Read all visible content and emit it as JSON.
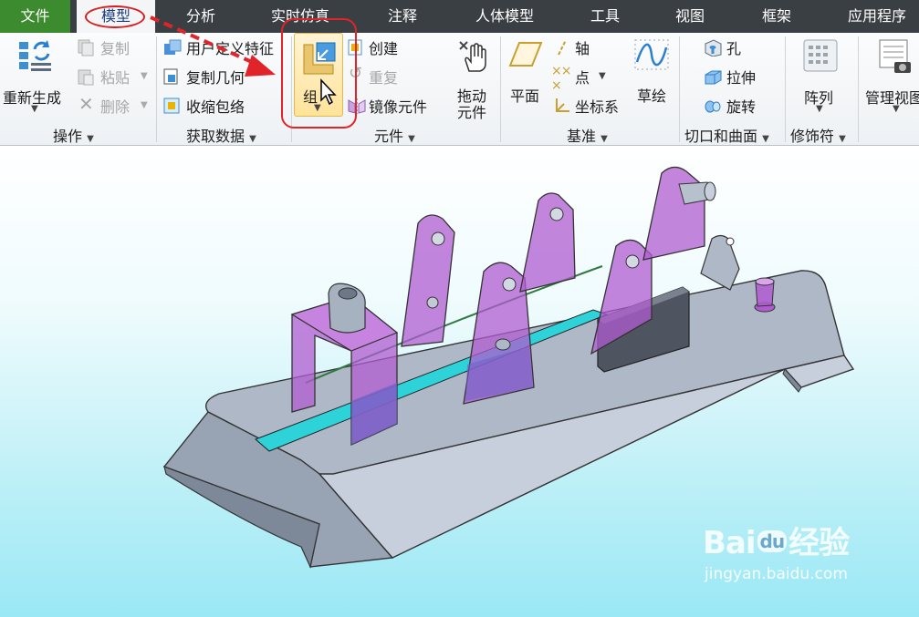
{
  "tabs": [
    {
      "key": "file",
      "label": "文件"
    },
    {
      "key": "model",
      "label": "模型"
    },
    {
      "key": "analysis",
      "label": "分析"
    },
    {
      "key": "sim",
      "label": "实时仿真"
    },
    {
      "key": "annot",
      "label": "注释"
    },
    {
      "key": "human",
      "label": "人体模型"
    },
    {
      "key": "tools",
      "label": "工具"
    },
    {
      "key": "view",
      "label": "视图"
    },
    {
      "key": "frame",
      "label": "框架"
    },
    {
      "key": "apps",
      "label": "应用程序"
    }
  ],
  "ribbon": {
    "operations": {
      "regenerate": "重新生成",
      "copy": "复制",
      "paste": "粘贴",
      "delete": "删除",
      "group": "操作"
    },
    "getdata": {
      "udf": "用户定义特征",
      "copy_geom": "复制几何",
      "shrinkwrap": "收缩包络",
      "group": "获取数据"
    },
    "components": {
      "group_btn": "组",
      "create": "创建",
      "repeat": "重复",
      "mirror": "镜像元件",
      "drag_line1": "拖动",
      "drag_line2": "元件",
      "group": "元件"
    },
    "datum": {
      "plane": "平面",
      "axis": "轴",
      "point": "点",
      "csys": "坐标系",
      "sketch": "草绘",
      "group": "基准"
    },
    "cut": {
      "hole": "孔",
      "extrude": "拉伸",
      "revolve": "旋转",
      "group": "切口和曲面"
    },
    "modifiers": {
      "pattern": "阵列",
      "group": "修饰符"
    },
    "manage": {
      "manage_view": "管理视图"
    }
  },
  "watermark": {
    "brand_latin": "Bai",
    "brand_paw": "du",
    "brand_cn": "经验",
    "url": "jingyan.baidu.com"
  },
  "colors": {
    "file_tab": "#3c8b2e",
    "tabbar": "#3a3f44",
    "annotation_red": "#e0242a",
    "part_body": "#a9b4c3",
    "purple_part": "#b05cd0",
    "cyan_strip": "#2dd3d8"
  }
}
